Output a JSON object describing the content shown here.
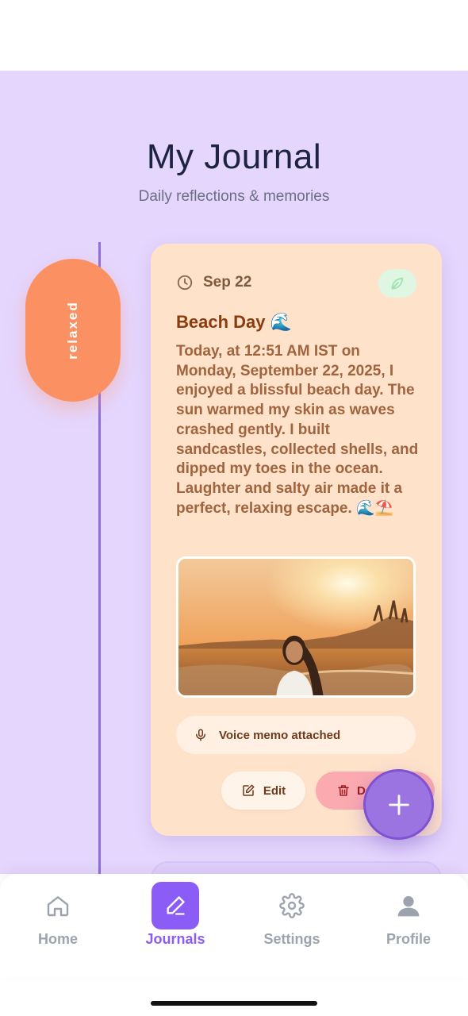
{
  "header": {
    "title": "My Journal",
    "subtitle": "Daily reflections & memories"
  },
  "entry": {
    "mood": "relaxed",
    "date": "Sep 22",
    "title": "Beach Day 🌊",
    "body": "Today, at 12:51 AM IST on Monday, September 22, 2025, I enjoyed a blissful beach day. The sun warmed my skin as waves crashed gently. I built sandcastles, collected shells, and dipped my toes in the ocean. Laughter and salty air made it a perfect, relaxing escape. 🌊⛱️",
    "voice_memo": "Voice memo attached",
    "edit_label": "Edit",
    "delete_label": "Delete"
  },
  "nav": {
    "items": [
      {
        "label": "Home",
        "icon": "home-icon"
      },
      {
        "label": "Journals",
        "icon": "pencil-icon",
        "active": true
      },
      {
        "label": "Settings",
        "icon": "gear-icon"
      },
      {
        "label": "Profile",
        "icon": "user-icon"
      }
    ]
  },
  "colors": {
    "background": "#e5d6fe",
    "card": "#fee2ca",
    "mood_pill": "#fb9163",
    "accent": "#8b5cf6"
  }
}
